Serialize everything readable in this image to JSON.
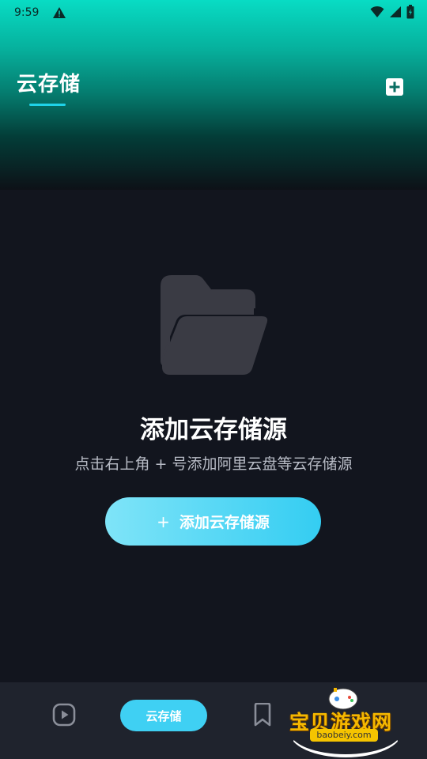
{
  "status_bar": {
    "time": "9:59"
  },
  "header": {
    "title": "云存储"
  },
  "empty_state": {
    "title": "添加云存储源",
    "subtitle": "点击右上角 + 号添加阿里云盘等云存储源",
    "button_plus": "+",
    "button_label": "添加云存储源"
  },
  "bottom_nav": {
    "active_label": "云存储"
  },
  "watermark": {
    "title": "宝贝游戏网",
    "url": "baobeiy.com"
  },
  "colors": {
    "accent": "#3fd0f3",
    "header_top": "#08dcc4",
    "background": "#12151e",
    "nav_bg": "#1f232d"
  },
  "icons": [
    "warning-icon",
    "wifi-icon",
    "signal-icon",
    "battery-icon",
    "add-square-icon",
    "folder-open-icon",
    "play-icon",
    "bookmark-icon"
  ]
}
